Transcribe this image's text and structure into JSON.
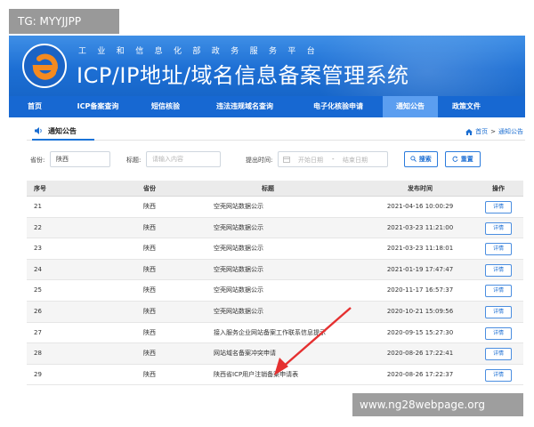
{
  "watermark": {
    "tag": "TG: MYYJJPP",
    "url": "www.ng28webpage.org"
  },
  "header": {
    "ministry": "工业和信息化部政务服务平台",
    "title": "ICP/IP地址/域名信息备案管理系统"
  },
  "nav": {
    "items": [
      {
        "label": "首页"
      },
      {
        "label": "ICP备案查询"
      },
      {
        "label": "短信核验"
      },
      {
        "label": "违法违规域名查询"
      },
      {
        "label": "电子化核验申请"
      },
      {
        "label": "通知公告"
      },
      {
        "label": "政策文件"
      }
    ],
    "active": "通知公告"
  },
  "section": {
    "title": "通知公告",
    "breadcrumb": {
      "home": "首页",
      "sep": ">",
      "current": "通知公告"
    }
  },
  "filters": {
    "province_label": "省份:",
    "province_value": "陕西",
    "title_label": "标题:",
    "title_placeholder": "请输入内容",
    "time_label": "提出时间:",
    "start_placeholder": "开始日期",
    "range_sep": "-",
    "end_placeholder": "结束日期",
    "search_label": "搜索",
    "reset_label": "重置"
  },
  "table": {
    "headers": [
      "序号",
      "省份",
      "标题",
      "发布时间",
      "操作"
    ],
    "rows": [
      {
        "no": "21",
        "province": "陕西",
        "title": "空壳网站数据公示",
        "time": "2021-04-16 10:00:29",
        "action": "详情"
      },
      {
        "no": "22",
        "province": "陕西",
        "title": "空壳网站数据公示",
        "time": "2021-03-23 11:21:00",
        "action": "详情"
      },
      {
        "no": "23",
        "province": "陕西",
        "title": "空壳网站数据公示",
        "time": "2021-03-23 11:18:01",
        "action": "详情"
      },
      {
        "no": "24",
        "province": "陕西",
        "title": "空壳网站数据公示",
        "time": "2021-01-19 17:47:47",
        "action": "详情"
      },
      {
        "no": "25",
        "province": "陕西",
        "title": "空壳网站数据公示",
        "time": "2020-11-17 16:57:37",
        "action": "详情"
      },
      {
        "no": "26",
        "province": "陕西",
        "title": "空壳网站数据公示",
        "time": "2020-10-21 15:09:56",
        "action": "详情"
      },
      {
        "no": "27",
        "province": "陕西",
        "title": "接入服务企业网站备案工作联系信息提示",
        "time": "2020-09-15 15:27:30",
        "action": "详情"
      },
      {
        "no": "28",
        "province": "陕西",
        "title": "网站域名备案冲突申请",
        "time": "2020-08-26 17:22:41",
        "action": "详情"
      },
      {
        "no": "29",
        "province": "陕西",
        "title": "陕西省ICP用户注销备案申请表",
        "time": "2020-08-26 17:22:37",
        "action": "详情"
      }
    ]
  },
  "colors": {
    "brand": "#1768d2",
    "active_tab": "#5b9ef0",
    "arrow": "#e53030"
  }
}
